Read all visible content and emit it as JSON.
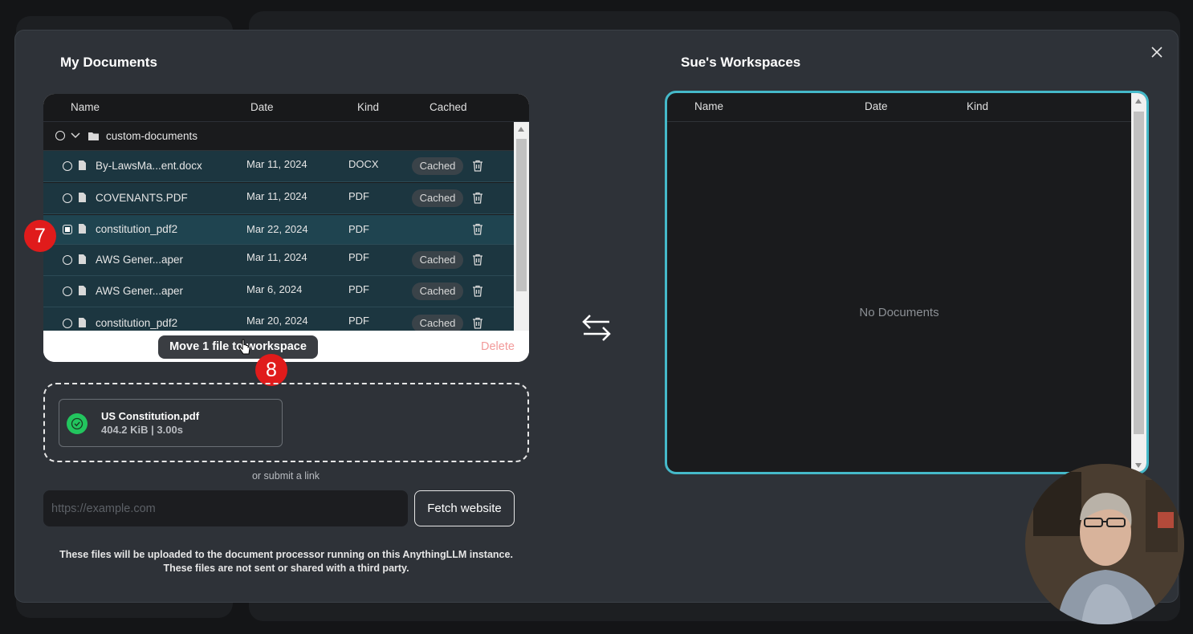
{
  "left": {
    "title": "My Documents",
    "columns": {
      "name": "Name",
      "date": "Date",
      "kind": "Kind",
      "cached": "Cached"
    },
    "folder": {
      "name": "custom-documents"
    },
    "files": [
      {
        "name": "By-LawsMa...ent.docx",
        "date": "Mar 11, 2024",
        "kind": "DOCX",
        "cached": "Cached"
      },
      {
        "name": "COVENANTS.PDF",
        "date": "Mar 11, 2024",
        "kind": "PDF",
        "cached": "Cached"
      },
      {
        "name": "constitution_pdf2",
        "date": "Mar 22, 2024",
        "kind": "PDF",
        "cached": ""
      },
      {
        "name": "AWS Gener...aper",
        "date": "Mar 11, 2024",
        "kind": "PDF",
        "cached": "Cached"
      },
      {
        "name": "AWS Gener...aper",
        "date": "Mar 6, 2024",
        "kind": "PDF",
        "cached": "Cached"
      },
      {
        "name": "constitution_pdf2",
        "date": "Mar 20, 2024",
        "kind": "PDF",
        "cached": "Cached"
      }
    ],
    "move_button": "Move 1 file to workspace",
    "delete_button": "Delete"
  },
  "step_badges": {
    "first": "7",
    "second": "8"
  },
  "upload": {
    "file_name": "US Constitution.pdf",
    "file_meta": "404.2 KiB | 3.00s",
    "submit_link": "or submit a link",
    "url_placeholder": "https://example.com",
    "fetch_button": "Fetch website",
    "disclaimer_line1": "These files will be uploaded to the document processor running on this AnythingLLM instance.",
    "disclaimer_line2": "These files are not sent or shared with a third party."
  },
  "right": {
    "title": "Sue's Workspaces",
    "columns": {
      "name": "Name",
      "date": "Date",
      "kind": "Kind"
    },
    "empty_text": "No Documents"
  },
  "colors": {
    "accent_border": "#45b9c9",
    "badge_red": "#e01b1b",
    "success_green": "#22c55e",
    "delete_red": "#f29a9a"
  },
  "icons": [
    "close-icon",
    "folder-icon",
    "chevron-down-icon",
    "file-icon",
    "trash-icon",
    "swap-arrows-icon",
    "check-circle-icon",
    "pointer-cursor-icon"
  ]
}
